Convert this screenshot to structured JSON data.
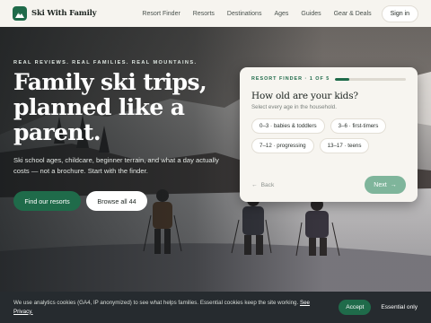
{
  "brand": {
    "name": "Ski With Family",
    "logo_icon": "mountain-icon",
    "accent": "#1f6b4a"
  },
  "nav": {
    "items": [
      {
        "label": "Resort Finder"
      },
      {
        "label": "Resorts"
      },
      {
        "label": "Destinations"
      },
      {
        "label": "Ages"
      },
      {
        "label": "Guides"
      },
      {
        "label": "Gear & Deals"
      }
    ],
    "signin_label": "Sign in"
  },
  "hero": {
    "eyebrow": "REAL REVIEWS. REAL FAMILIES. REAL MOUNTAINS.",
    "headline_lines": [
      "Family ski trips,",
      "planned like a",
      "parent."
    ],
    "subtitle": "Ski school ages, childcare, beginner terrain, and what a day actually costs — not a brochure. Start with the finder.",
    "primary_cta": "Find our resorts",
    "secondary_cta": "Browse all 44"
  },
  "finder": {
    "step_label": "RESORT FINDER · 1 OF 5",
    "progress": 0.2,
    "question": "How old are your kids?",
    "hint": "Select every age in the household.",
    "options": [
      {
        "label": "0–3 · babies & toddlers"
      },
      {
        "label": "3–6 · first-timers"
      },
      {
        "label": "7–12 · progressing"
      },
      {
        "label": "13–17 · teens"
      }
    ],
    "back_label": "Back",
    "next_label": "Next"
  },
  "cookie": {
    "text": "We use analytics cookies (GA4, IP anonymized) to see what helps families. Essential cookies keep the site working.",
    "privacy_link": "See Privacy.",
    "accept_label": "Accept",
    "essential_label": "Essential only"
  }
}
